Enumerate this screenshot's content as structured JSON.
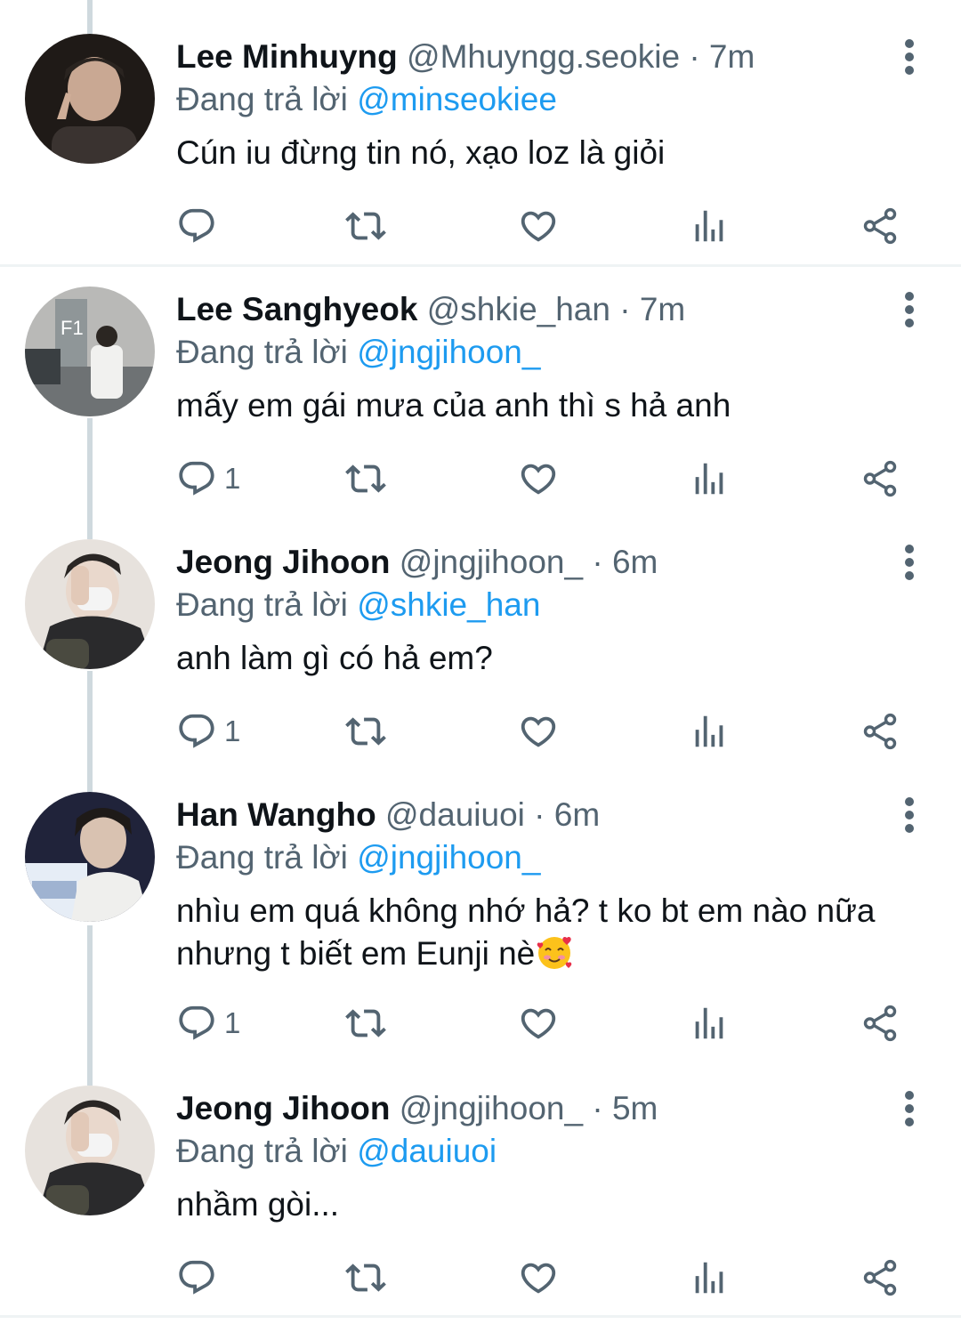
{
  "tweets": [
    {
      "name": "Lee Minhuyng",
      "handle": "@Mhuyngg.seokie",
      "dot": "·",
      "time": "7m",
      "replying_prefix": "Đang trả lời",
      "replying_to": "@minseokiee",
      "text": "Cún iu đừng tin nó, xạo loz là giỏi",
      "reply_count": ""
    },
    {
      "name": "Lee Sanghyeok",
      "handle": "@shkie_han",
      "dot": "·",
      "time": "7m",
      "replying_prefix": "Đang trả lời",
      "replying_to": "@jngjihoon_",
      "text": "mấy em gái mưa của anh thì s hả anh",
      "reply_count": "1"
    },
    {
      "name": "Jeong Jihoon",
      "handle": "@jngjihoon_",
      "dot": "·",
      "time": "6m",
      "replying_prefix": "Đang trả lời",
      "replying_to": "@shkie_han",
      "text": "anh làm gì có hả em?",
      "reply_count": "1"
    },
    {
      "name": "Han Wangho",
      "handle": "@dauiuoi",
      "dot": "·",
      "time": "6m",
      "replying_prefix": "Đang trả lời",
      "replying_to": "@jngjihoon_",
      "text_line1": "nhìu em quá không nhớ hả? t ko bt em nào nữa",
      "text_line2": "nhưng t biết em Eunji nè",
      "text_emoji": "smiling-face-with-hearts",
      "reply_count": "1"
    },
    {
      "name": "Jeong Jihoon",
      "handle": "@jngjihoon_",
      "dot": "·",
      "time": "5m",
      "replying_prefix": "Đang trả lời",
      "replying_to": "@dauiuoi",
      "text": "nhầm gòi...",
      "reply_count": ""
    }
  ],
  "icons": {
    "reply": "reply-icon",
    "retweet": "retweet-icon",
    "like": "heart-icon",
    "views": "analytics-icon",
    "share": "share-icon",
    "more": "more-vertical-icon"
  },
  "colors": {
    "link": "#1d9bf0",
    "secondary": "#536471",
    "thread_line": "#cfd9de"
  }
}
